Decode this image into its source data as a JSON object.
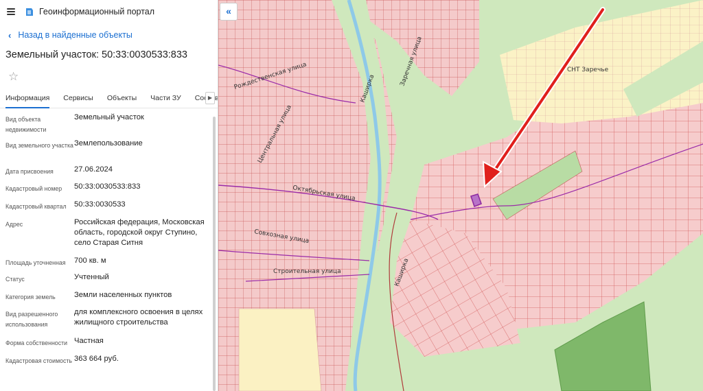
{
  "header": {
    "title": "Геоинформационный портал"
  },
  "back_link": "Назад в найденные объекты",
  "object_title": "Земельный участок: 50:33:0030533:833",
  "tabs": [
    "Информация",
    "Сервисы",
    "Объекты",
    "Части ЗУ",
    "Состав"
  ],
  "info": [
    {
      "label": "Вид объекта недвижимости",
      "value": "Земельный участок"
    },
    {
      "label": "Вид земельного участка",
      "value": "Землепользование"
    },
    {
      "label": "Дата присвоения",
      "value": "27.06.2024"
    },
    {
      "label": "Кадастровый номер",
      "value": "50:33:0030533:833"
    },
    {
      "label": "Кадастровый квартал",
      "value": "50:33:0030533"
    },
    {
      "label": "Адрес",
      "value": "Российская федерация, Московская область, городской округ Ступино, село Старая Ситня"
    },
    {
      "label": "Площадь уточненная",
      "value": "700 кв. м"
    },
    {
      "label": "Статус",
      "value": "Учтенный"
    },
    {
      "label": "Категория земель",
      "value": "Земли населенных пунктов"
    },
    {
      "label": "Вид разрешенного использования",
      "value": "для комплексного освоения в целях жилищного строительства"
    },
    {
      "label": "Форма собственности",
      "value": "Частная"
    },
    {
      "label": "Кадастровая стоимость",
      "value": "363 664 руб."
    }
  ],
  "map": {
    "labels": {
      "snt": "СНТ Заречье",
      "rozhd": "Рождественская улица",
      "oktyabr": "Октябрьская улица",
      "tsentr": "Центральная улица",
      "sovkhoz": "Совхозная улица",
      "stroit": "Строительная улица",
      "zarech": "Заречная улица",
      "kashirka": "Каширка"
    },
    "colors": {
      "parcel": "#f6c9c9",
      "parcel_line": "#d64a4a",
      "forest": "#cde6b8",
      "river": "#8ec9e8",
      "snt": "#fbf3c4",
      "arrow": "#e0201c",
      "selected": "#8e2ca0"
    }
  }
}
